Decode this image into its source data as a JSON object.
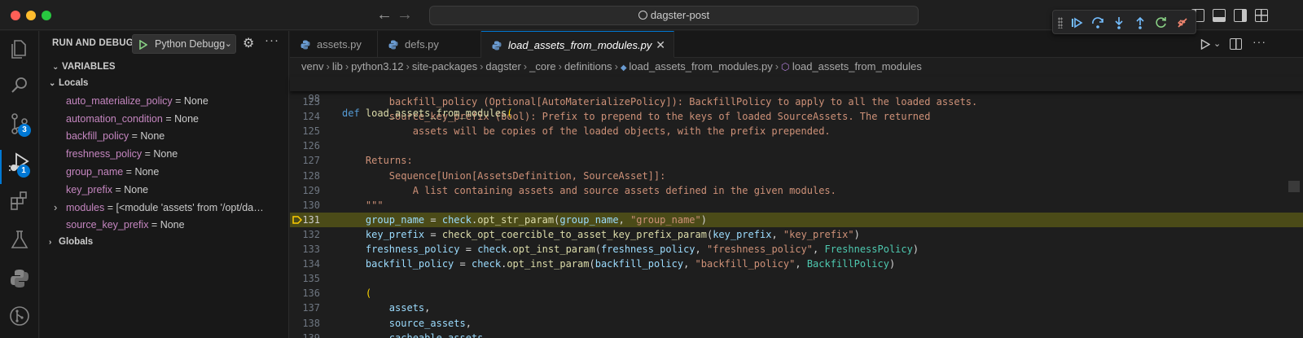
{
  "window": {
    "title": "dagster-post",
    "back_arrow": "←",
    "forward_arrow": "→"
  },
  "debug_toolbar": {
    "buttons": [
      "continue-icon",
      "step-over-icon",
      "step-into-icon",
      "step-out-icon",
      "restart-icon",
      "disconnect-icon"
    ]
  },
  "activity_bar": {
    "source_control_badge": "3",
    "run_debug_badge": "1"
  },
  "sidebar": {
    "header": "RUN AND DEBUG",
    "config_label": "Python Debugg",
    "variables_label": "VARIABLES",
    "locals_label": "Locals",
    "globals_label": "Globals",
    "locals": [
      {
        "name": "auto_materialize_policy",
        "eq": " = ",
        "value": "None",
        "expandable": false
      },
      {
        "name": "automation_condition",
        "eq": " = ",
        "value": "None",
        "expandable": false
      },
      {
        "name": "backfill_policy",
        "eq": " = ",
        "value": "None",
        "expandable": false
      },
      {
        "name": "freshness_policy",
        "eq": " = ",
        "value": "None",
        "expandable": false
      },
      {
        "name": "group_name",
        "eq": " = ",
        "value": "None",
        "expandable": false
      },
      {
        "name": "key_prefix",
        "eq": " = ",
        "value": "None",
        "expandable": false
      },
      {
        "name": "modules",
        "eq": " = ",
        "value": "[<module 'assets' from '/opt/da…",
        "expandable": true
      },
      {
        "name": "source_key_prefix",
        "eq": " = ",
        "value": "None",
        "expandable": false
      }
    ]
  },
  "tabs": [
    {
      "label": "assets.py",
      "active": false
    },
    {
      "label": "defs.py",
      "active": false
    },
    {
      "label": "load_assets_from_modules.py",
      "active": true,
      "close": "✕"
    }
  ],
  "breadcrumbs": [
    "venv",
    "lib",
    "python3.12",
    "site-packages",
    "dagster",
    "_core",
    "definitions",
    "load_assets_from_modules.py",
    "load_assets_from_modules"
  ],
  "code": {
    "sticky": {
      "num": "98",
      "kw": "def ",
      "fn": "load_assets_from_modules",
      "rest": "("
    },
    "current_line": "131",
    "lines": [
      {
        "num": "123",
        "parts": [
          [
            "doc",
            "        backfill_policy (Optional[AutoMaterializePolicy]): BackfillPolicy to apply to all the loaded assets."
          ]
        ]
      },
      {
        "num": "124",
        "parts": [
          [
            "doc",
            "        source_key_prefix (bool): Prefix to prepend to the keys of loaded SourceAssets. The returned"
          ]
        ]
      },
      {
        "num": "125",
        "parts": [
          [
            "doc",
            "            assets will be copies of the loaded objects, with the prefix prepended."
          ]
        ]
      },
      {
        "num": "126",
        "parts": [
          [
            "doc",
            ""
          ]
        ]
      },
      {
        "num": "127",
        "parts": [
          [
            "doc",
            "    Returns:"
          ]
        ]
      },
      {
        "num": "128",
        "parts": [
          [
            "doc",
            "        Sequence[Union[AssetsDefinition, SourceAsset]]:"
          ]
        ]
      },
      {
        "num": "129",
        "parts": [
          [
            "doc",
            "            A list containing assets and source assets defined in the given modules."
          ]
        ]
      },
      {
        "num": "130",
        "parts": [
          [
            "doc",
            "    \"\"\""
          ]
        ]
      },
      {
        "num": "131",
        "parts": [
          [
            "plain",
            "    "
          ],
          [
            "var",
            "group_name"
          ],
          [
            "plain",
            " = "
          ],
          [
            "var",
            "check"
          ],
          [
            "plain",
            "."
          ],
          [
            "fn",
            "opt_str_param"
          ],
          [
            "plain",
            "("
          ],
          [
            "var",
            "group_name"
          ],
          [
            "plain",
            ", "
          ],
          [
            "str",
            "\"group_name\""
          ],
          [
            "plain",
            ")"
          ]
        ]
      },
      {
        "num": "132",
        "parts": [
          [
            "plain",
            "    "
          ],
          [
            "var",
            "key_prefix"
          ],
          [
            "plain",
            " = "
          ],
          [
            "fn",
            "check_opt_coercible_to_asset_key_prefix_param"
          ],
          [
            "plain",
            "("
          ],
          [
            "var",
            "key_prefix"
          ],
          [
            "plain",
            ", "
          ],
          [
            "str",
            "\"key_prefix\""
          ],
          [
            "plain",
            ")"
          ]
        ]
      },
      {
        "num": "133",
        "parts": [
          [
            "plain",
            "    "
          ],
          [
            "var",
            "freshness_policy"
          ],
          [
            "plain",
            " = "
          ],
          [
            "var",
            "check"
          ],
          [
            "plain",
            "."
          ],
          [
            "fn",
            "opt_inst_param"
          ],
          [
            "plain",
            "("
          ],
          [
            "var",
            "freshness_policy"
          ],
          [
            "plain",
            ", "
          ],
          [
            "str",
            "\"freshness_policy\""
          ],
          [
            "plain",
            ", "
          ],
          [
            "cls",
            "FreshnessPolicy"
          ],
          [
            "plain",
            ")"
          ]
        ]
      },
      {
        "num": "134",
        "parts": [
          [
            "plain",
            "    "
          ],
          [
            "var",
            "backfill_policy"
          ],
          [
            "plain",
            " = "
          ],
          [
            "var",
            "check"
          ],
          [
            "plain",
            "."
          ],
          [
            "fn",
            "opt_inst_param"
          ],
          [
            "plain",
            "("
          ],
          [
            "var",
            "backfill_policy"
          ],
          [
            "plain",
            ", "
          ],
          [
            "str",
            "\"backfill_policy\""
          ],
          [
            "plain",
            ", "
          ],
          [
            "cls",
            "BackfillPolicy"
          ],
          [
            "plain",
            ")"
          ]
        ]
      },
      {
        "num": "135",
        "parts": [
          [
            "plain",
            ""
          ]
        ]
      },
      {
        "num": "136",
        "parts": [
          [
            "plain",
            "    "
          ],
          [
            "punct",
            "("
          ]
        ]
      },
      {
        "num": "137",
        "parts": [
          [
            "plain",
            "        "
          ],
          [
            "var",
            "assets"
          ],
          [
            "plain",
            ","
          ]
        ]
      },
      {
        "num": "138",
        "parts": [
          [
            "plain",
            "        "
          ],
          [
            "var",
            "source_assets"
          ],
          [
            "plain",
            ","
          ]
        ]
      },
      {
        "num": "139",
        "parts": [
          [
            "plain",
            "        "
          ],
          [
            "var",
            "cacheable_assets"
          ],
          [
            "plain",
            ","
          ]
        ]
      }
    ]
  },
  "colors": {
    "accent": "#0078d4",
    "highlight_line": "#4b4b18",
    "breakpoint": "#ffcc00"
  }
}
